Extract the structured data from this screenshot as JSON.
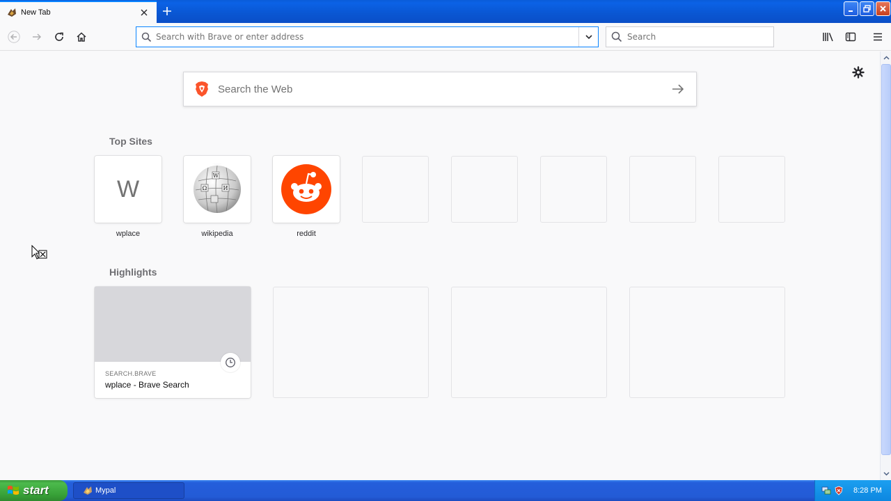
{
  "tab": {
    "title": "New Tab"
  },
  "navbar": {
    "url_placeholder": "Search with Brave or enter address",
    "search_placeholder": "Search"
  },
  "newtab": {
    "web_search_placeholder": "Search the Web",
    "top_sites_title": "Top Sites",
    "top_sites": [
      {
        "label": "wplace",
        "letter": "W"
      },
      {
        "label": "wikipedia"
      },
      {
        "label": "reddit"
      }
    ],
    "highlights_title": "Highlights",
    "highlights": [
      {
        "host": "SEARCH.BRAVE",
        "title": "wplace - Brave Search"
      }
    ]
  },
  "taskbar": {
    "start_label": "start",
    "window_label": "Mypal",
    "clock": "8:28 PM"
  },
  "colors": {
    "accent": "#0a84ff",
    "reddit": "#ff4500",
    "brave": "#fb542b"
  }
}
